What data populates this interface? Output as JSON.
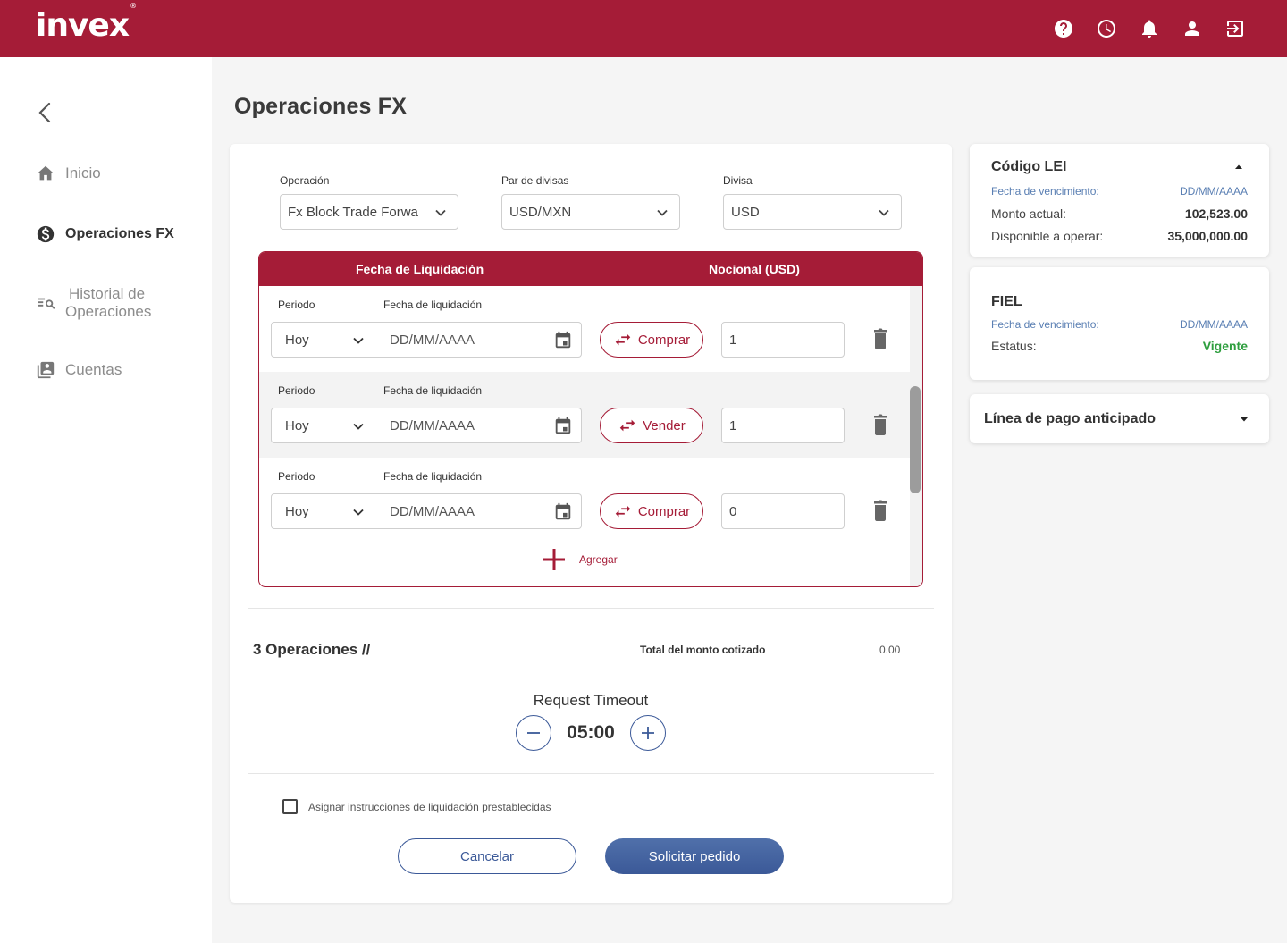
{
  "brand": {
    "logo_text": "invex",
    "logo_mark": "®",
    "primary": "#a51c37",
    "accent_blue": "#3b5998",
    "success": "#2e9e3e"
  },
  "topbar": {
    "icons": [
      "help-icon",
      "clock-icon",
      "bell-icon",
      "user-icon",
      "logout-icon"
    ]
  },
  "sidebar": {
    "items": [
      {
        "label": "Inicio",
        "icon": "home-icon",
        "active": false
      },
      {
        "label": "Operaciones FX",
        "icon": "dollar-icon",
        "active": true
      },
      {
        "label_line1": "Historial de",
        "label_line2": "Operaciones",
        "icon": "search-list-icon",
        "active": false
      },
      {
        "label": "Cuentas",
        "icon": "accounts-icon",
        "active": false
      }
    ]
  },
  "page": {
    "title": "Operaciones FX"
  },
  "form": {
    "operacion": {
      "label": "Operación",
      "value": "Fx Block Trade Forwa"
    },
    "par": {
      "label": "Par de divisas",
      "value": "USD/MXN"
    },
    "divisa": {
      "label": "Divisa",
      "value": "USD"
    }
  },
  "table": {
    "headers": {
      "fecha": "Fecha de Liquidación",
      "nocional": "Nocional (USD)"
    },
    "rows": [
      {
        "periodo_label": "Periodo",
        "fecha_label": "Fecha de liquidación",
        "periodo": "Hoy",
        "fecha_placeholder": "DD/MM/AAAA",
        "action": "Comprar",
        "amount": "1"
      },
      {
        "periodo_label": "Periodo",
        "fecha_label": "Fecha de liquidación",
        "periodo": "Hoy",
        "fecha_placeholder": "DD/MM/AAAA",
        "action": "Vender",
        "amount": "1"
      },
      {
        "periodo_label": "Periodo",
        "fecha_label": "Fecha de liquidación",
        "periodo": "Hoy",
        "fecha_placeholder": "DD/MM/AAAA",
        "action": "Comprar",
        "amount": "0"
      }
    ],
    "add_label": "Agregar"
  },
  "summary": {
    "ops_count": "3 Operaciones //",
    "total_label": "Total del monto cotizado",
    "total_value": "0.00"
  },
  "timeout": {
    "title": "Request Timeout",
    "value": "05:00"
  },
  "checkbox": {
    "label": "Asignar instrucciones de liquidación prestablecidas",
    "checked": false
  },
  "buttons": {
    "cancel": "Cancelar",
    "submit": "Solicitar pedido"
  },
  "lei": {
    "title": "Código LEI",
    "venc_label": "Fecha de vencimiento:",
    "venc_value": "DD/MM/AAAA",
    "monto_label": "Monto actual:",
    "monto_value": "102,523.00",
    "disp_label": "Disponible a operar:",
    "disp_value": "35,000,000.00"
  },
  "fiel": {
    "title": "FIEL",
    "venc_label": "Fecha de vencimiento:",
    "venc_value": "DD/MM/AAAA",
    "estatus_label": "Estatus:",
    "estatus_value": "Vigente"
  },
  "linea": {
    "title": "Línea de pago anticipado"
  }
}
